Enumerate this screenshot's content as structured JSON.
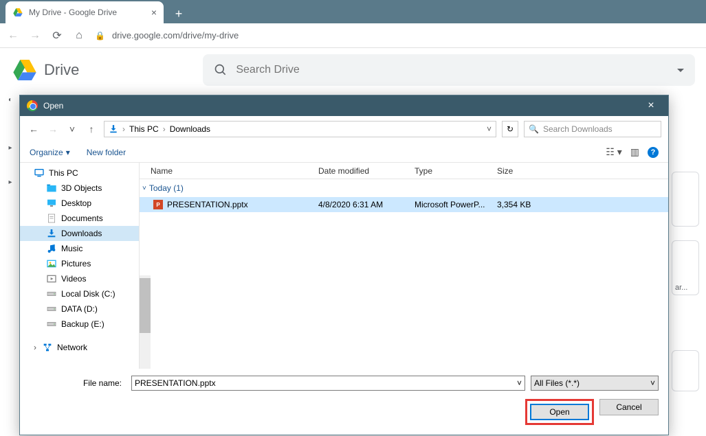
{
  "browser": {
    "tab_title": "My Drive - Google Drive",
    "url": "drive.google.com/drive/my-drive"
  },
  "drive": {
    "brand": "Drive",
    "search_placeholder": "Search Drive"
  },
  "dialog": {
    "title": "Open",
    "breadcrumb": {
      "root": "This PC",
      "folder": "Downloads"
    },
    "search_placeholder": "Search Downloads",
    "toolbar": {
      "organize": "Organize",
      "new_folder": "New folder"
    },
    "tree": [
      {
        "label": "This PC",
        "icon": "monitor",
        "indent": false
      },
      {
        "label": "3D Objects",
        "icon": "folder3d",
        "indent": true
      },
      {
        "label": "Desktop",
        "icon": "desktop",
        "indent": true
      },
      {
        "label": "Documents",
        "icon": "docs",
        "indent": true
      },
      {
        "label": "Downloads",
        "icon": "downloads",
        "indent": true,
        "selected": true
      },
      {
        "label": "Music",
        "icon": "music",
        "indent": true
      },
      {
        "label": "Pictures",
        "icon": "pictures",
        "indent": true
      },
      {
        "label": "Videos",
        "icon": "videos",
        "indent": true
      },
      {
        "label": "Local Disk (C:)",
        "icon": "drive",
        "indent": true
      },
      {
        "label": "DATA (D:)",
        "icon": "drive",
        "indent": true
      },
      {
        "label": "Backup (E:)",
        "icon": "drive",
        "indent": true
      },
      {
        "label": "Network",
        "icon": "network",
        "indent": false
      }
    ],
    "columns": {
      "name": "Name",
      "date": "Date modified",
      "type": "Type",
      "size": "Size"
    },
    "group": "Today (1)",
    "files": [
      {
        "name": "PRESENTATION.pptx",
        "date": "4/8/2020 6:31 AM",
        "type": "Microsoft PowerP...",
        "size": "3,354 KB"
      }
    ],
    "filename_label": "File name:",
    "filename_value": "PRESENTATION.pptx",
    "filetype": "All Files (*.*)",
    "open": "Open",
    "cancel": "Cancel"
  },
  "peek": {
    "truncated": "ar..."
  }
}
